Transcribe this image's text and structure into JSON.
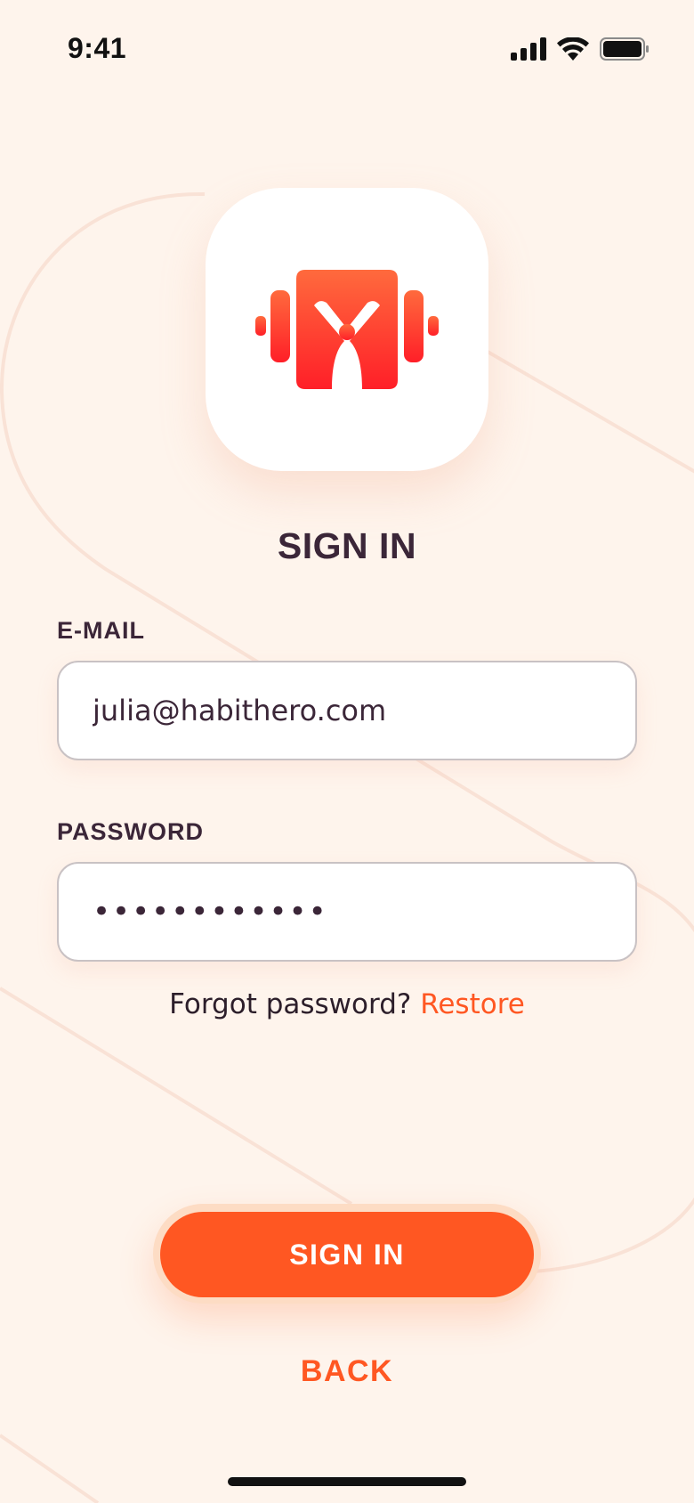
{
  "status_bar": {
    "time": "9:41",
    "icons": [
      "cellular-signal-icon",
      "wifi-icon",
      "battery-icon"
    ]
  },
  "logo": {
    "icon": "habit-hero-logo-icon",
    "colors": {
      "top": "#ff6a3d",
      "bottom": "#ff1f28"
    }
  },
  "title": "SIGN IN",
  "form": {
    "email": {
      "label": "E-MAIL",
      "value": "julia@habithero.com"
    },
    "password": {
      "label": "PASSWORD",
      "masked_value": "••••••••••••"
    }
  },
  "forgot": {
    "prompt": "Forgot password?",
    "link": "Restore"
  },
  "actions": {
    "sign_in": "SIGN IN",
    "back": "BACK"
  },
  "theme": {
    "background": "#fef4ec",
    "accent": "#ff5722",
    "text": "#3b2638"
  }
}
